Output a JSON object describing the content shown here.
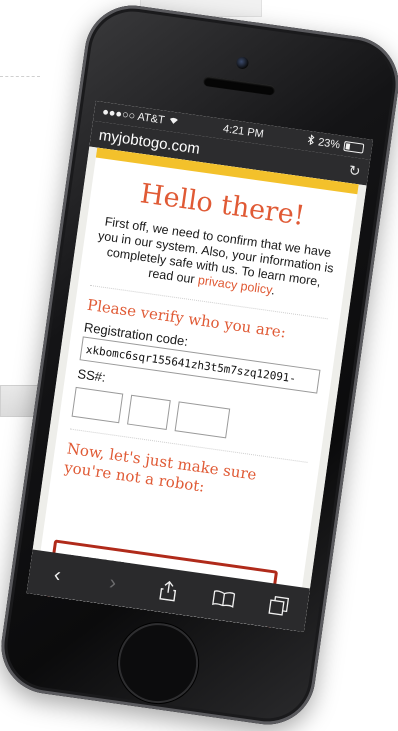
{
  "statusbar": {
    "carrier": "●●●○○ AT&T",
    "wifi_icon": "wifi-icon",
    "time": "4:21 PM",
    "bluetooth_icon": "bluetooth-icon",
    "battery": "23%"
  },
  "browser": {
    "url": "myjobtogo.com",
    "reload_icon": "reload-icon"
  },
  "page": {
    "heading": "Hello there!",
    "intro": "First off, we need to confirm that we have you in our system. Also, your information is completely safe with us. To learn more, read our",
    "privacy_link": "privacy policy",
    "period": ".",
    "verify_title": "Please verify who you are:",
    "registration_label": "Registration code:",
    "registration_value": "xkbomc6sqr155641zh3t5m7szq12091-",
    "ss_label": "SS#:",
    "robot_title": "Now, let's just make sure you're not a robot:"
  },
  "toolbar": {
    "back": "‹",
    "forward": "›",
    "share": "⇪",
    "bookmarks": "📖",
    "tabs": "❐"
  },
  "colors": {
    "accent": "#e05a35",
    "top_bar": "#f3c12b",
    "captcha_border": "#b02a1a"
  }
}
